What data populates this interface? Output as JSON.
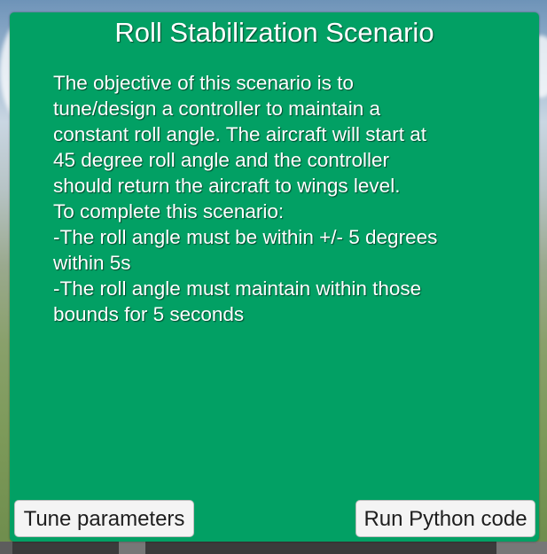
{
  "dialog": {
    "title": "Roll Stabilization Scenario",
    "body_lines": [
      "The objective of this scenario is to",
      "tune/design a controller to maintain a",
      "constant roll angle. The aircraft will start at",
      "45 degree roll angle and the controller",
      "should return the aircraft to wings level.",
      "To complete this scenario:",
      "-The roll angle must be within +/- 5 degrees",
      "within 5s",
      "-The roll angle must maintain within those",
      "bounds for 5 seconds"
    ],
    "buttons": {
      "tune_label": "Tune parameters",
      "run_label": "Run Python code"
    }
  },
  "colors": {
    "dialog_bg": "#02a064",
    "button_bg": "#f4f4f4",
    "text": "#ffffff"
  }
}
